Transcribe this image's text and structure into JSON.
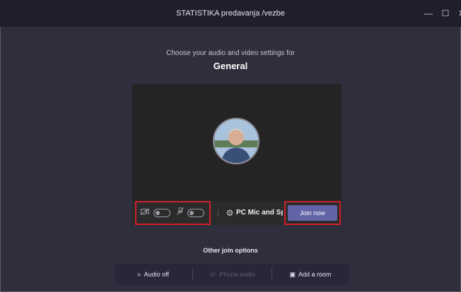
{
  "window": {
    "title": "STATISTIKA predavanja /vezbe",
    "min_icon": "minimize-icon",
    "max_icon": "maximize-icon",
    "close_icon": "close-icon"
  },
  "prejoin": {
    "subtitle": "Choose your audio and video settings for",
    "channel": "General"
  },
  "toolbar": {
    "camera_icon": "camera-off-icon",
    "mic_icon": "mic-off-icon",
    "settings_icon": "gear-icon",
    "device_label": "PC Mic and Sp...",
    "join_label": "Join now"
  },
  "other_join": {
    "label": "Other join options",
    "options": [
      {
        "label": "Audio off",
        "icon": "speaker-off-icon"
      },
      {
        "label": "Phone audio",
        "icon": "phone-icon"
      },
      {
        "label": "Add a room",
        "icon": "room-icon"
      }
    ]
  },
  "colors": {
    "accent": "#6264a7",
    "highlight": "#d0202b",
    "background": "#2f2e3d"
  }
}
